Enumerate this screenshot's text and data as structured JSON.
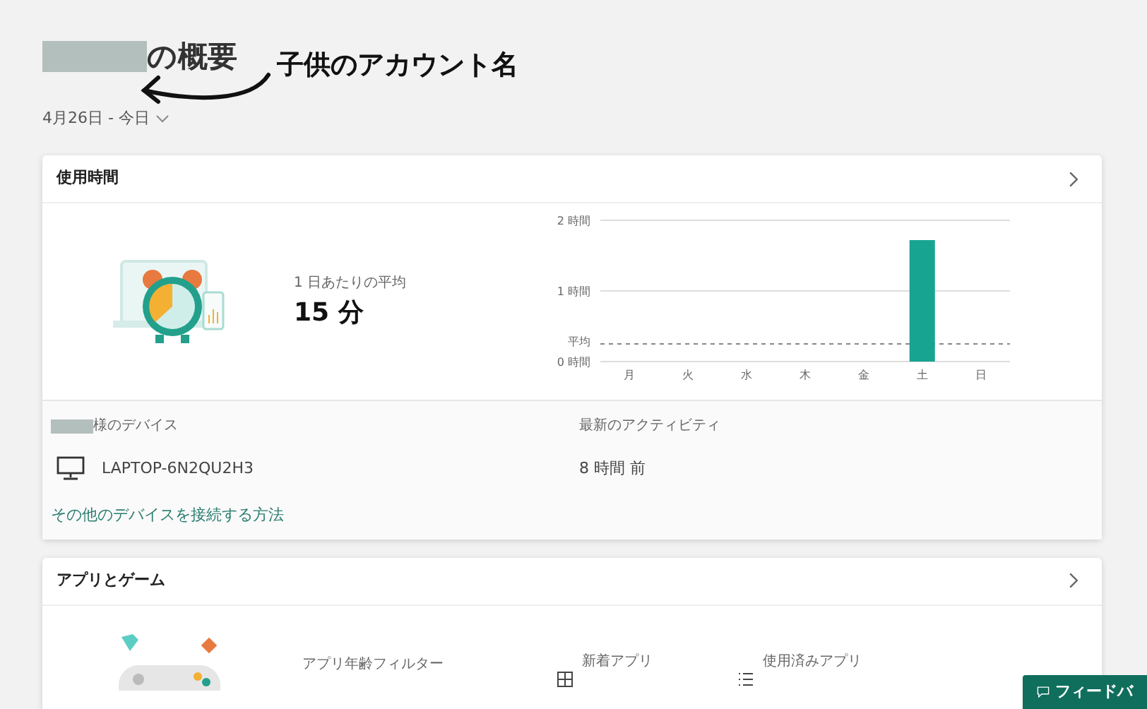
{
  "page": {
    "title_suffix": "の概要",
    "annotation": "子供のアカウント名",
    "date_range": "4月26日 - 今日"
  },
  "screen_time": {
    "title": "使用時間",
    "average_label": "1 日あたりの平均",
    "average_value": "15 分",
    "chart_data": {
      "type": "bar",
      "categories": [
        "月",
        "火",
        "水",
        "木",
        "金",
        "土",
        "日"
      ],
      "values": [
        0,
        0,
        0,
        0,
        0,
        1.72,
        0
      ],
      "ylim": [
        0,
        2
      ],
      "yticks": [
        {
          "value": 0,
          "label": "0 時間"
        },
        {
          "value": 1,
          "label": "1 時間"
        },
        {
          "value": 2,
          "label": "2 時間"
        }
      ],
      "ref_lines": [
        {
          "value": 0.25,
          "label": "平均",
          "axis": "y"
        }
      ]
    },
    "devices_label_suffix": "様のデバイス",
    "activity_label": "最新のアクティビティ",
    "devices": [
      {
        "name": "LAPTOP-6N2QU2H3",
        "last_activity": "8 時間 前"
      }
    ],
    "connect_link": "その他のデバイスを接続する方法"
  },
  "apps_and_games": {
    "title": "アプリとゲーム",
    "age_filter_label": "アプリ年齢フィルター",
    "new_apps_label": "新着アプリ",
    "used_apps_label": "使用済みアプリ"
  },
  "feedback_button": "フィードバ"
}
